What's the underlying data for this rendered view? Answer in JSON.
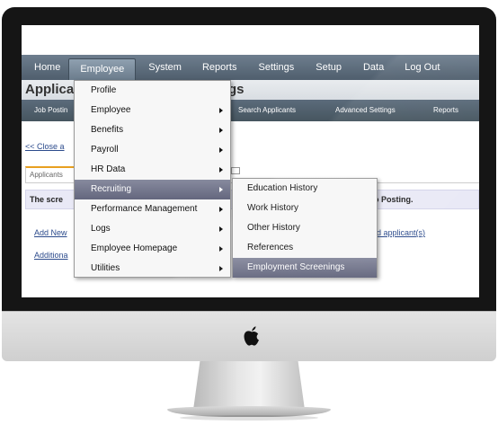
{
  "navbar": {
    "items": [
      "Home",
      "Employee",
      "System",
      "Reports",
      "Settings",
      "Setup",
      "Data",
      "Log Out"
    ],
    "active": "Employee"
  },
  "page": {
    "title_left": "Applica",
    "title_right": "gs"
  },
  "subnav": {
    "items": [
      "Job Postin",
      "Search Applicants",
      "Advanced Settings",
      "Reports"
    ]
  },
  "content": {
    "close_link": "<< Close a",
    "tab_label": "Applicants",
    "info_bar_left": "The scre",
    "info_bar_right": "o Posting.",
    "add_new_link": "Add New",
    "add_tail_link": "d applicant(s)",
    "additional_link": "Additiona"
  },
  "main_menu": {
    "items": [
      {
        "label": "Profile",
        "has_submenu": false
      },
      {
        "label": "Employee",
        "has_submenu": true
      },
      {
        "label": "Benefits",
        "has_submenu": true
      },
      {
        "label": "Payroll",
        "has_submenu": true
      },
      {
        "label": "HR Data",
        "has_submenu": true
      },
      {
        "label": "Recruiting",
        "has_submenu": true
      },
      {
        "label": "Performance Management",
        "has_submenu": true
      },
      {
        "label": "Logs",
        "has_submenu": true
      },
      {
        "label": "Employee Homepage",
        "has_submenu": true
      },
      {
        "label": "Utilities",
        "has_submenu": true
      }
    ],
    "highlighted": "Recruiting"
  },
  "sub_menu": {
    "items": [
      {
        "label": "Education History"
      },
      {
        "label": "Work History"
      },
      {
        "label": "Other History"
      },
      {
        "label": "References"
      },
      {
        "label": "Employment Screenings"
      }
    ],
    "highlighted": "Employment Screenings"
  },
  "colors": {
    "navbar": "#5f6f7f",
    "menu_highlight": "#76798f",
    "link": "#2c4b8c",
    "bezel": "#151515"
  },
  "icons": {
    "logo": "apple-logo-icon",
    "submenu_arrow": "chevron-right-icon"
  }
}
